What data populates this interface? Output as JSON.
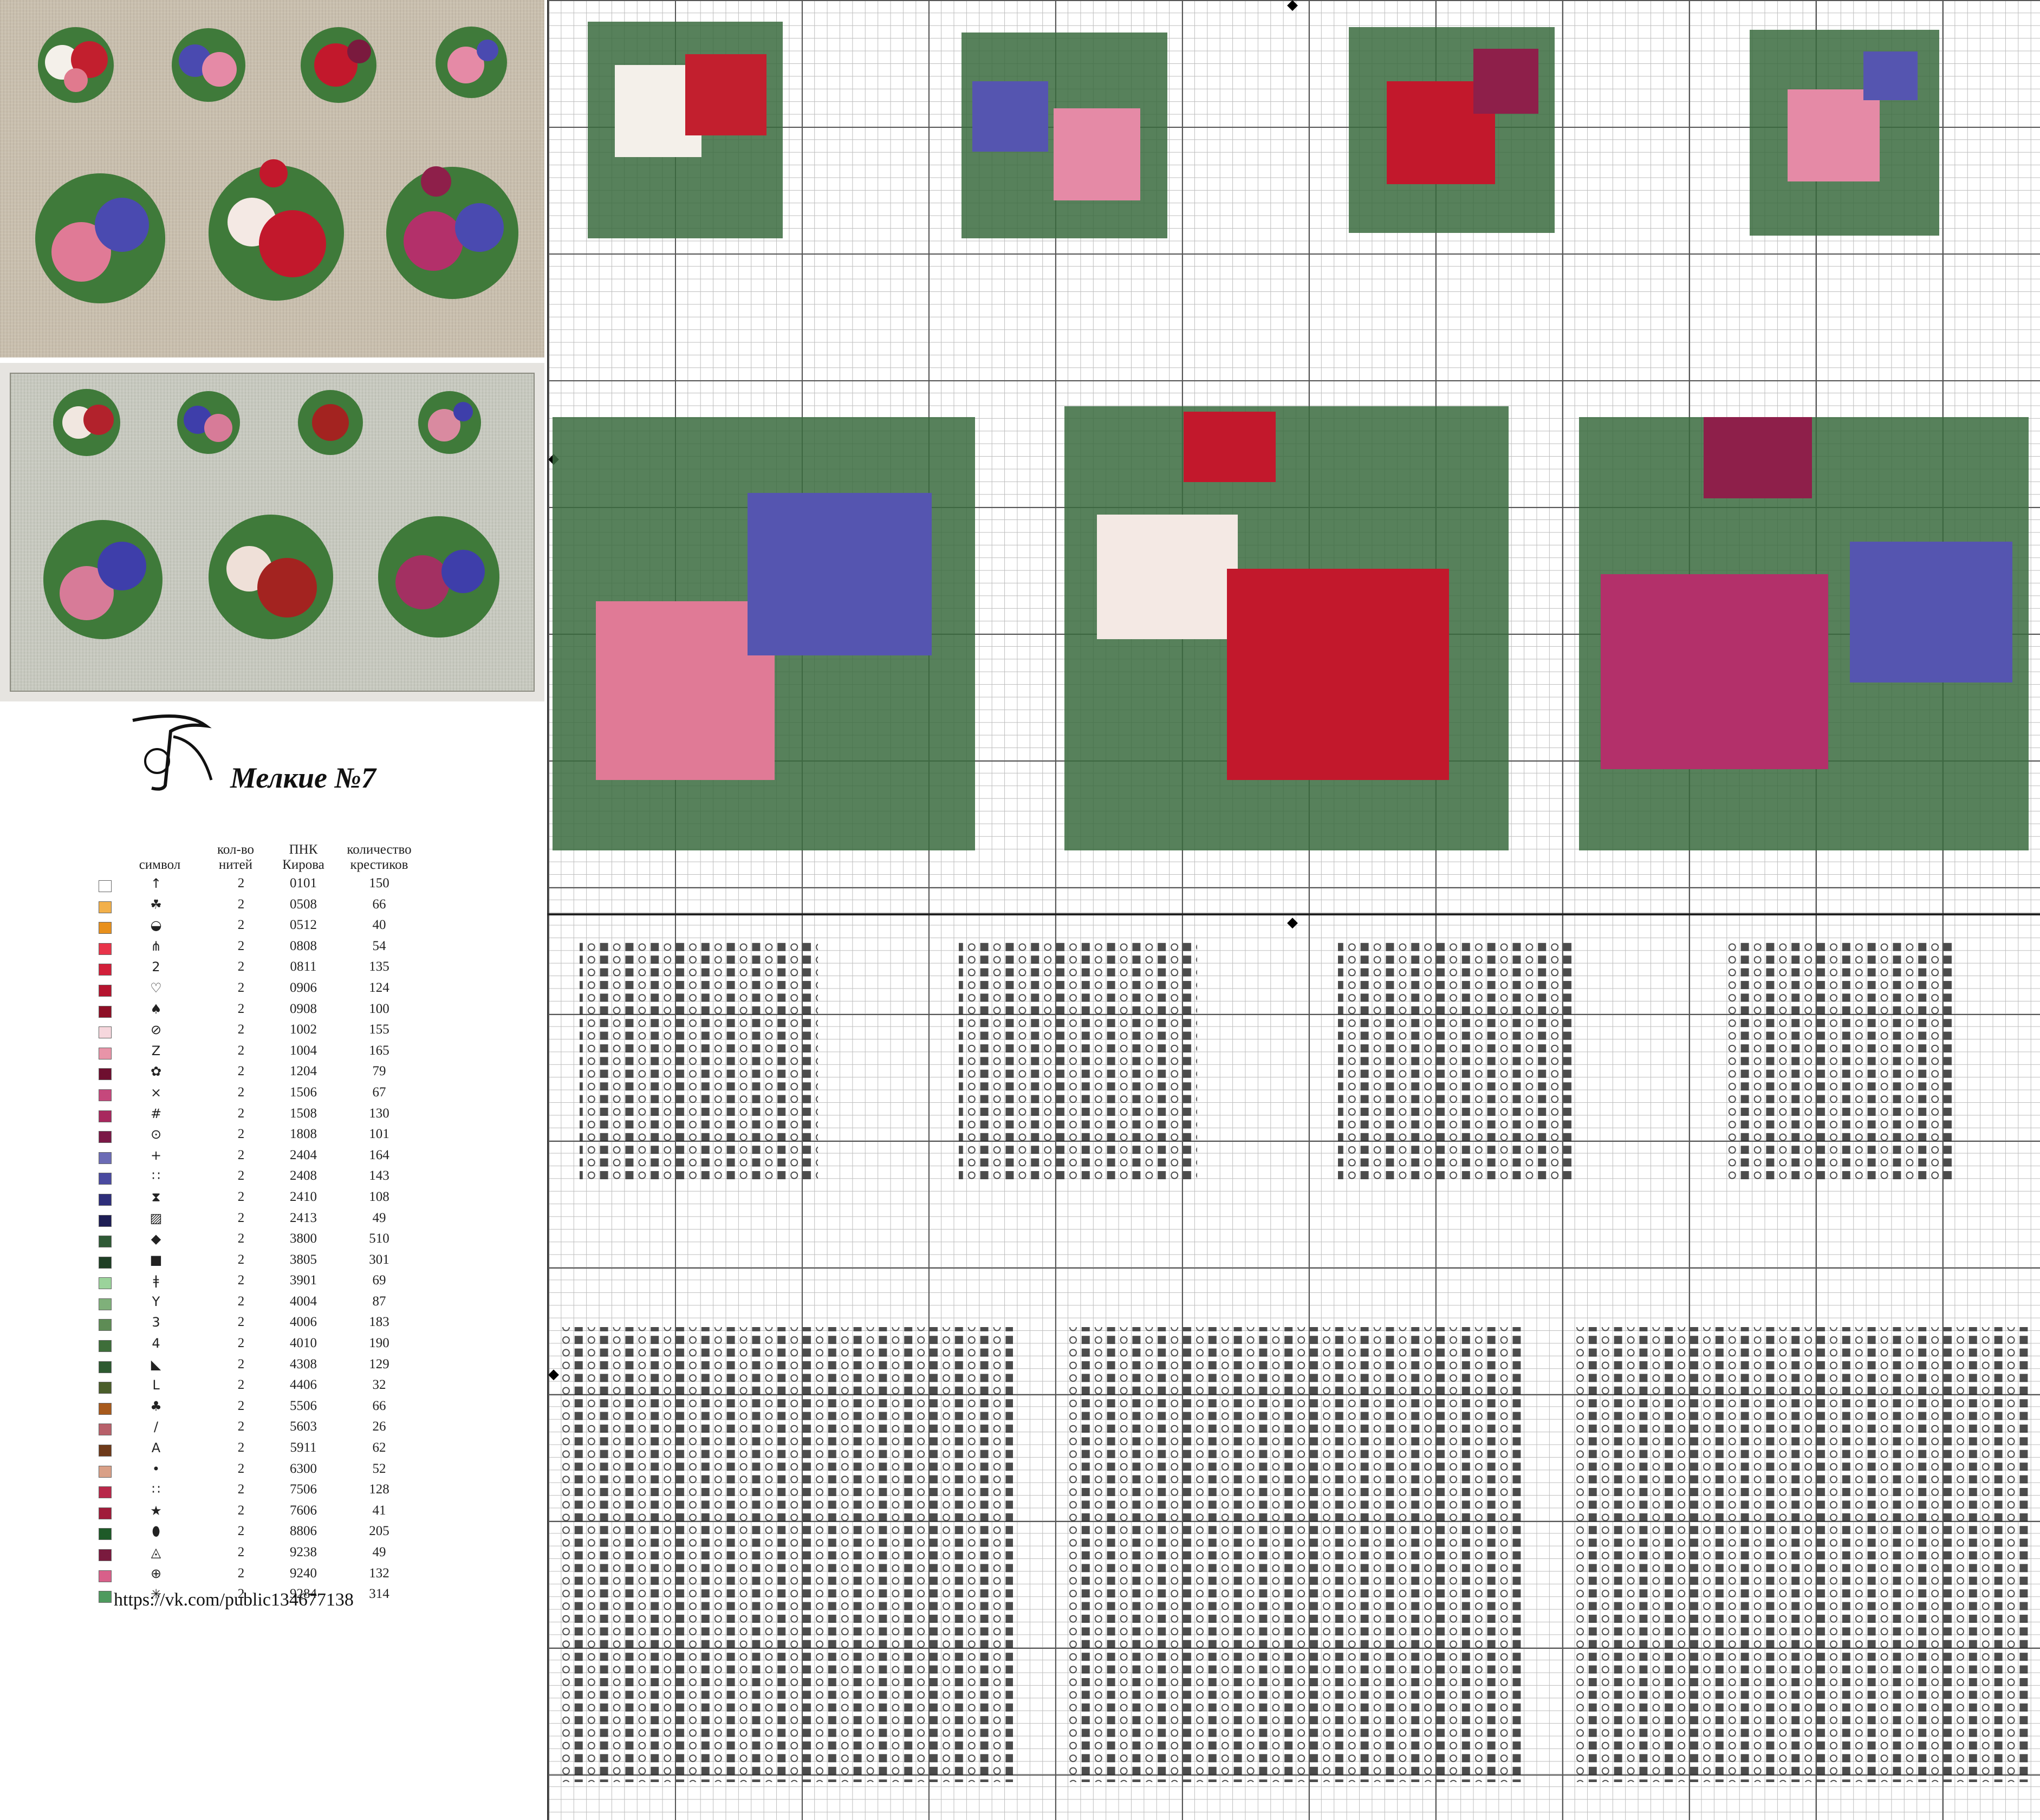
{
  "title": "Мелкие №7",
  "legend": {
    "headers": {
      "symbol": "символ",
      "threads": "кол-во нитей",
      "code": "ПНК Кирова",
      "count": "количество крестиков"
    },
    "rows": [
      {
        "color": "#ffffff",
        "symbol": "↑",
        "threads": "2",
        "code": "0101",
        "count": "150"
      },
      {
        "color": "#f2b04a",
        "symbol": "☘",
        "threads": "2",
        "code": "0508",
        "count": "66"
      },
      {
        "color": "#e8901c",
        "symbol": "◒",
        "threads": "2",
        "code": "0512",
        "count": "40"
      },
      {
        "color": "#e8344a",
        "symbol": "⋔",
        "threads": "2",
        "code": "0808",
        "count": "54"
      },
      {
        "color": "#d21f3a",
        "symbol": "2",
        "threads": "2",
        "code": "0811",
        "count": "135"
      },
      {
        "color": "#b5142f",
        "symbol": "♡",
        "threads": "2",
        "code": "0906",
        "count": "124"
      },
      {
        "color": "#8e0f26",
        "symbol": "♠",
        "threads": "2",
        "code": "0908",
        "count": "100"
      },
      {
        "color": "#f6d7dd",
        "symbol": "⊘",
        "threads": "2",
        "code": "1002",
        "count": "155"
      },
      {
        "color": "#e894a8",
        "symbol": "Z",
        "threads": "2",
        "code": "1004",
        "count": "165"
      },
      {
        "color": "#6e0f2f",
        "symbol": "✿",
        "threads": "2",
        "code": "1204",
        "count": "79"
      },
      {
        "color": "#c5487c",
        "symbol": "⨯",
        "threads": "2",
        "code": "1506",
        "count": "67"
      },
      {
        "color": "#a8285e",
        "symbol": "#",
        "threads": "2",
        "code": "1508",
        "count": "130"
      },
      {
        "color": "#7a1846",
        "symbol": "⊙",
        "threads": "2",
        "code": "1808",
        "count": "101"
      },
      {
        "color": "#6b6bb5",
        "symbol": "+",
        "threads": "2",
        "code": "2404",
        "count": "164"
      },
      {
        "color": "#4a4aa0",
        "symbol": "∷",
        "threads": "2",
        "code": "2408",
        "count": "143"
      },
      {
        "color": "#2e2e7a",
        "symbol": "⧗",
        "threads": "2",
        "code": "2410",
        "count": "108"
      },
      {
        "color": "#1e1e55",
        "symbol": "▨",
        "threads": "2",
        "code": "2413",
        "count": "49"
      },
      {
        "color": "#2f5a36",
        "symbol": "◆",
        "threads": "2",
        "code": "3800",
        "count": "510"
      },
      {
        "color": "#1f3f25",
        "symbol": "■",
        "threads": "2",
        "code": "3805",
        "count": "301"
      },
      {
        "color": "#9bd39b",
        "symbol": "ǂ",
        "threads": "2",
        "code": "3901",
        "count": "69"
      },
      {
        "color": "#7fb07a",
        "symbol": "Y",
        "threads": "2",
        "code": "4004",
        "count": "87"
      },
      {
        "color": "#5e8c55",
        "symbol": "3",
        "threads": "2",
        "code": "4006",
        "count": "183"
      },
      {
        "color": "#3e6e3a",
        "symbol": "4",
        "threads": "2",
        "code": "4010",
        "count": "190"
      },
      {
        "color": "#2d5a30",
        "symbol": "◣",
        "threads": "2",
        "code": "4308",
        "count": "129"
      },
      {
        "color": "#4a5e2a",
        "symbol": "L",
        "threads": "2",
        "code": "4406",
        "count": "32"
      },
      {
        "color": "#a85a1c",
        "symbol": "♣",
        "threads": "2",
        "code": "5506",
        "count": "66"
      },
      {
        "color": "#b8606a",
        "symbol": "∕",
        "threads": "2",
        "code": "5603",
        "count": "26"
      },
      {
        "color": "#6e3a1a",
        "symbol": "A",
        "threads": "2",
        "code": "5911",
        "count": "62"
      },
      {
        "color": "#d9a087",
        "symbol": "•",
        "threads": "2",
        "code": "6300",
        "count": "52"
      },
      {
        "color": "#b8284a",
        "symbol": "∷",
        "threads": "2",
        "code": "7506",
        "count": "128"
      },
      {
        "color": "#a01c3a",
        "symbol": "★",
        "threads": "2",
        "code": "7606",
        "count": "41"
      },
      {
        "color": "#1e5a28",
        "symbol": "⬮",
        "threads": "2",
        "code": "8806",
        "count": "205"
      },
      {
        "color": "#7a1a3e",
        "symbol": "◬",
        "threads": "2",
        "code": "9238",
        "count": "49"
      },
      {
        "color": "#d8608a",
        "symbol": "⊕",
        "threads": "2",
        "code": "9240",
        "count": "132"
      },
      {
        "color": "#4e9a5e",
        "symbol": "✳",
        "threads": "2",
        "code": "9284",
        "count": "314"
      }
    ]
  },
  "url": "https://vk.com/public134677138",
  "markers": {
    "center_arrow": "◆"
  }
}
